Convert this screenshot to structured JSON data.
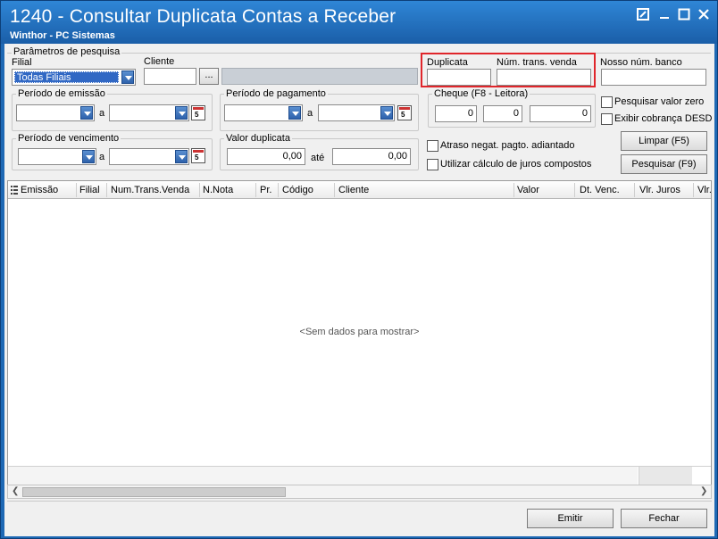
{
  "window": {
    "title": "1240 - Consultar Duplicata Contas a Receber",
    "subtitle": "Winthor - PC Sistemas",
    "controls": [
      "restore-icon",
      "minimize-icon",
      "maximize-icon",
      "close-icon"
    ]
  },
  "params": {
    "group_label": "Parâmetros de pesquisa",
    "filial_label": "Filial",
    "filial_value": "Todas Filiais",
    "cliente_label": "Cliente",
    "cliente_value": "",
    "cliente_button": "...",
    "duplicata_label": "Duplicata",
    "duplicata_value": "",
    "num_trans_label": "Núm. trans. venda",
    "num_trans_value": "",
    "nosso_num_label": "Nosso núm. banco",
    "nosso_num_value": ""
  },
  "periodo_emissao": {
    "label": "Período de emissão",
    "separator": "a",
    "from": "",
    "to": ""
  },
  "periodo_pagamento": {
    "label": "Período de pagamento",
    "separator": "a",
    "from": "",
    "to": ""
  },
  "periodo_vencimento": {
    "label": "Período de vencimento",
    "separator": "a",
    "from": "",
    "to": ""
  },
  "cheque": {
    "label": "Cheque (F8 - Leitora)",
    "v1": "0",
    "v2": "0",
    "v3": "0"
  },
  "valor_duplicata": {
    "label": "Valor duplicata",
    "from": "0,00",
    "sep": "até",
    "to": "0,00"
  },
  "options": {
    "pesquisar_valor_zero": "Pesquisar valor zero",
    "exibir_cobranca": "Exibir cobrança  DESD",
    "atraso_negat": "Atraso negat. pagto. adiantado",
    "utilizar_calculo": "Utilizar cálculo de juros compostos"
  },
  "buttons": {
    "limpar": "Limpar (F5)",
    "pesquisar": "Pesquisar (F9)",
    "emitir": "Emitir",
    "fechar": "Fechar"
  },
  "grid": {
    "columns": [
      "Emissão",
      "Filial",
      "Num.Trans.Venda",
      "N.Nota",
      "Pr.",
      "Código",
      "Cliente",
      "Valor",
      "Dt. Venc.",
      "Vlr. Juros",
      "Vlr."
    ],
    "empty_text": "<Sem dados para mostrar>"
  },
  "accent_color": "#1e68b4",
  "highlight_color": "#e0262b"
}
